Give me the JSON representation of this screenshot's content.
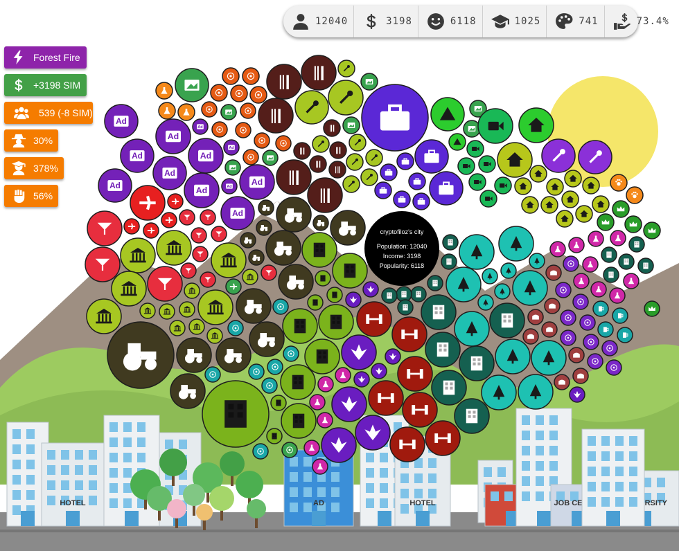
{
  "stats": [
    {
      "icon": "person-icon",
      "value": "12040"
    },
    {
      "icon": "dollar-icon",
      "value": "3198"
    },
    {
      "icon": "smile-icon",
      "value": "6118"
    },
    {
      "icon": "graduation-cap-icon",
      "value": "1025"
    },
    {
      "icon": "palette-icon",
      "value": "741"
    },
    {
      "icon": "hand-dollar-icon",
      "value": "73.4%"
    }
  ],
  "badges": [
    {
      "icon": "lightning-icon",
      "label": "Forest Fire",
      "color": "#8e24aa"
    },
    {
      "icon": "dollar-icon",
      "label": "+3198 SIM",
      "color": "#43a047"
    },
    {
      "icon": "users-icon",
      "label": "539 (-8 SIM)",
      "color": "#f57c00"
    },
    {
      "icon": "detective-icon",
      "label": "30%",
      "color": "#f57c00"
    },
    {
      "icon": "graduate-icon",
      "label": "378%",
      "color": "#f57c00"
    },
    {
      "icon": "fist-icon",
      "label": "56%",
      "color": "#f57c00"
    }
  ],
  "city": {
    "name": "cryptofiloz's city",
    "population": "Population: 12040",
    "income": "Income: 3198",
    "popularity": "Popularity: 6118"
  },
  "signs": {
    "hotel": "HOTEL",
    "ad": "AD",
    "gym": "GYM",
    "job_center": "JOB CENTER",
    "university": "UNIVERSITY"
  },
  "colors": {
    "sky": "#ffffff",
    "sun": "#f5e66a",
    "mountain": "#9e8f82",
    "hill": "#9dcb60",
    "road": "#8a8a8a",
    "industry_green": "#a7c722",
    "tractor": "#403a20",
    "restaurant": "#541e1a",
    "work": "#7bb31c",
    "business": "#5b28d6",
    "camp": "#2ccc2e",
    "video": "#19b856",
    "home": "#b7c71b",
    "utility": "#8b30d8",
    "ads": "#7421b8",
    "gallery": "#39a34e",
    "coin": "#e55a13",
    "science": "#f5891a",
    "airport": "#e72020",
    "cocktail": "#e72e3e",
    "office": "#2a9d2a",
    "gym": "#a01a0e",
    "tree": "#1ec1b2",
    "skyscraper": "#156050",
    "temple": "#a04040",
    "atom": "#7b28c8",
    "flask": "#d028a8",
    "cannabis": "#6a1dc0",
    "beer": "#1aa7a7"
  }
}
